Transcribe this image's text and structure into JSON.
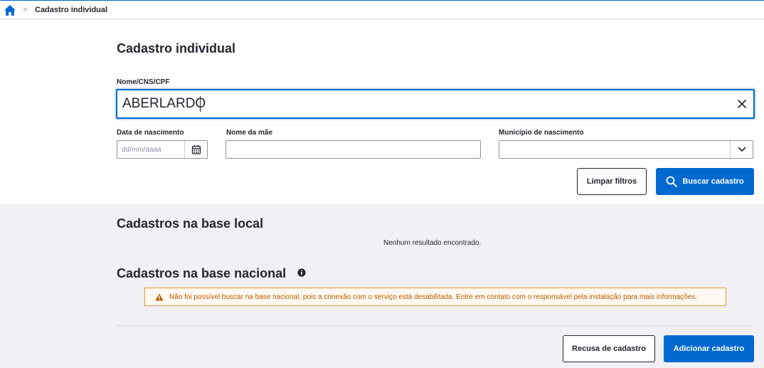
{
  "breadcrumb": {
    "home_icon": "home-icon",
    "separator": ">",
    "current": "Cadastro individual"
  },
  "page": {
    "title": "Cadastro individual"
  },
  "search": {
    "label": "Nome/CNS/CPF",
    "value": "ABERLARDO",
    "clear_icon": "close-icon"
  },
  "filters": {
    "birth_date": {
      "label": "Data de nascimento",
      "value": "",
      "placeholder": "dd/mm/aaaa",
      "icon": "calendar-icon"
    },
    "mother_name": {
      "label": "Nome da mãe",
      "value": "",
      "placeholder": ""
    },
    "birth_city": {
      "label": "Município de nascimento",
      "value": "",
      "placeholder": "",
      "icon": "chevron-down-icon"
    }
  },
  "actions": {
    "clear_label": "Limpar filtros",
    "search_label": "Buscar cadastro",
    "search_icon": "search-icon"
  },
  "local_base": {
    "title": "Cadastros na base local",
    "empty_message": "Nenhum resultado encontrado."
  },
  "national_base": {
    "title": "Cadastros na base nacional",
    "info_icon": "info-icon",
    "alert_icon": "warning-icon",
    "alert_message": "Não foi possível buscar na base nacional, pois a conexão com o serviço está desabilitada. Entre em contato com o responsável pela instalação para mais informações."
  },
  "footer": {
    "refuse_label": "Recusa de cadastro",
    "add_label": "Adicionar cadastro"
  },
  "colors": {
    "primary": "#0069d0",
    "text": "#24252e",
    "warning_border": "#e39c3e",
    "warning_text": "#b85c00",
    "section_background": "#f0f0f5"
  }
}
